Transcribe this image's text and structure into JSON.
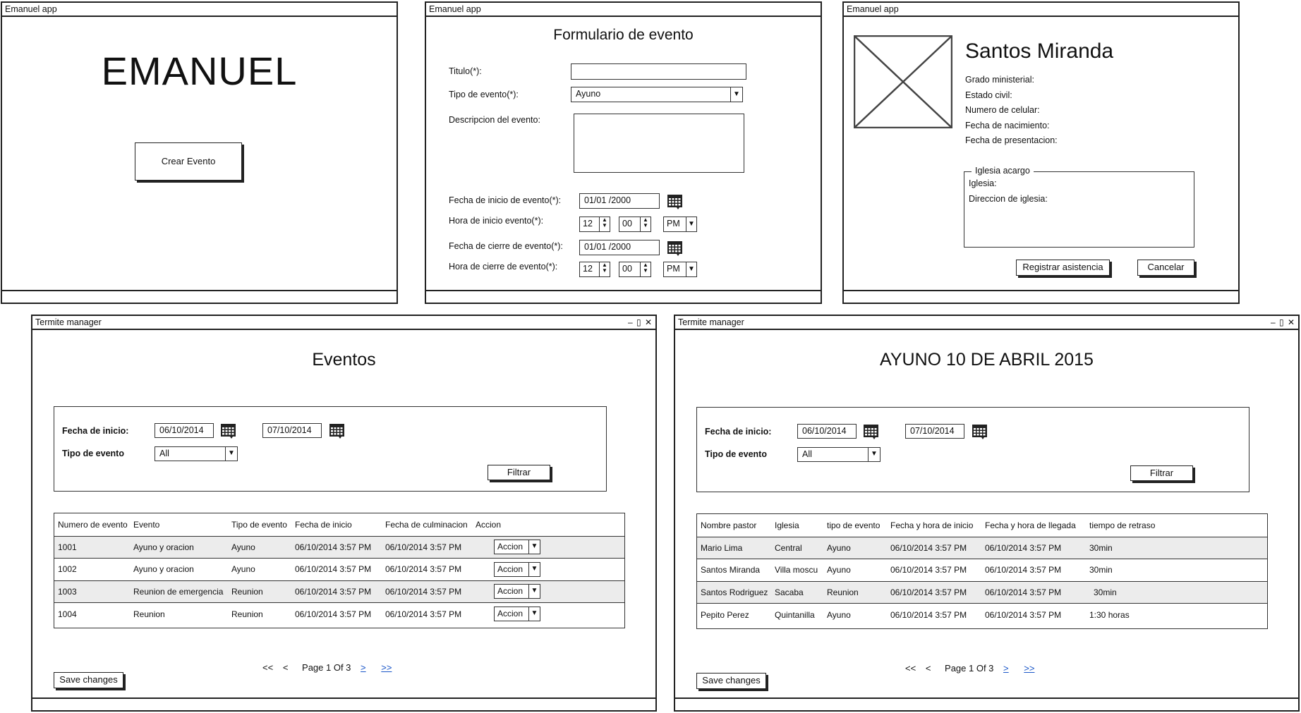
{
  "window_title": "Emanuel app",
  "termite_title": "Termite manager",
  "window_controls": "– ▯ ✕",
  "home": {
    "logo": "EMANUEL",
    "create_button": "Crear Evento"
  },
  "form": {
    "heading": "Formulario de evento",
    "titulo_label": "Titulo(*):",
    "titulo_value": "",
    "tipo_label": "Tipo de evento(*):",
    "tipo_value": "Ayuno",
    "descripcion_label": "Descripcion del evento:",
    "descripcion_value": "",
    "fecha_inicio_label": "Fecha de inicio de evento(*):",
    "fecha_inicio_value": "01/01 /2000",
    "hora_inicio_label": "Hora de inicio evento(*):",
    "hora_inicio_hour": "12",
    "hora_inicio_min": "00",
    "hora_inicio_ampm": "PM",
    "fecha_cierre_label": "Fecha de cierre de evento(*):",
    "fecha_cierre_value": "01/01 /2000",
    "hora_cierre_label": "Hora de cierre de evento(*):",
    "hora_cierre_hour": "12",
    "hora_cierre_min": "00",
    "hora_cierre_ampm": "PM"
  },
  "profile": {
    "name": "Santos Miranda",
    "fields": [
      "Grado ministerial:",
      "Estado civil:",
      "Numero de celular:",
      "Fecha de nacimiento:",
      "Fecha de presentacion:"
    ],
    "group_title": "Iglesia acargo",
    "group_fields": [
      "Iglesia:",
      "Direccion de iglesia:"
    ],
    "register_button": "Registrar asistencia",
    "cancel_button": "Cancelar"
  },
  "eventos": {
    "heading": "Eventos",
    "fecha_label": "Fecha de inicio:",
    "fecha_from": "06/10/2014",
    "fecha_to": "07/10/2014",
    "tipo_label": "Tipo de evento",
    "tipo_value": "All",
    "filter_button": "Filtrar",
    "columns": [
      "Numero de evento",
      "Evento",
      "Tipo de evento",
      "Fecha de inicio",
      "Fecha de culminacion",
      "Accion"
    ],
    "rows": [
      {
        "num": "1001",
        "evento": "Ayuno y oracion",
        "tipo": "Ayuno",
        "inicio": "06/10/2014 3:57 PM",
        "fin": "06/10/2014 3:57 PM",
        "accion": "Accion"
      },
      {
        "num": "1002",
        "evento": "Ayuno y oracion",
        "tipo": "Ayuno",
        "inicio": "06/10/2014 3:57 PM",
        "fin": "06/10/2014 3:57 PM",
        "accion": "Accion"
      },
      {
        "num": "1003",
        "evento": "Reunion de emergencia",
        "tipo": "Reunion",
        "inicio": "06/10/2014 3:57 PM",
        "fin": "06/10/2014 3:57 PM",
        "accion": "Accion"
      },
      {
        "num": "1004",
        "evento": "Reunion",
        "tipo": "Reunion",
        "inicio": "06/10/2014 3:57 PM",
        "fin": "06/10/2014 3:57 PM",
        "accion": "Accion"
      }
    ],
    "pager": {
      "first": "<<",
      "prev": "<",
      "label": "Page 1 Of 3",
      "next": ">",
      "last": ">>"
    },
    "save_button": "Save changes"
  },
  "ayuno": {
    "heading": "AYUNO 10 DE ABRIL 2015",
    "fecha_label": "Fecha de inicio:",
    "fecha_from": "06/10/2014",
    "fecha_to": "07/10/2014",
    "tipo_label": "Tipo de evento",
    "tipo_value": "All",
    "filter_button": "Filtrar",
    "columns": [
      "Nombre pastor",
      "Iglesia",
      "tipo de evento",
      "Fecha y hora de inicio",
      "Fecha y hora de llegada",
      "tiempo de retraso"
    ],
    "rows": [
      {
        "pastor": "Mario Lima",
        "iglesia": "Central",
        "tipo": "Ayuno",
        "inicio": "06/10/2014 3:57 PM",
        "llegada": "06/10/2014 3:57 PM",
        "retraso": "30min"
      },
      {
        "pastor": "Santos Miranda",
        "iglesia": "Villa moscu",
        "tipo": "Ayuno",
        "inicio": "06/10/2014 3:57 PM",
        "llegada": "06/10/2014 3:57 PM",
        "retraso": "30min"
      },
      {
        "pastor": "Santos Rodriguez",
        "iglesia": "Sacaba",
        "tipo": "Reunion",
        "inicio": "06/10/2014 3:57 PM",
        "llegada": "06/10/2014 3:57 PM",
        "retraso": "30min"
      },
      {
        "pastor": "Pepito Perez",
        "iglesia": "Quintanilla",
        "tipo": "Ayuno",
        "inicio": "06/10/2014 3:57 PM",
        "llegada": "06/10/2014 3:57 PM",
        "retraso": "1:30 horas"
      }
    ],
    "pager": {
      "first": "<<",
      "prev": "<",
      "label": "Page 1 Of 3",
      "next": ">",
      "last": ">>"
    },
    "save_button": "Save changes"
  }
}
